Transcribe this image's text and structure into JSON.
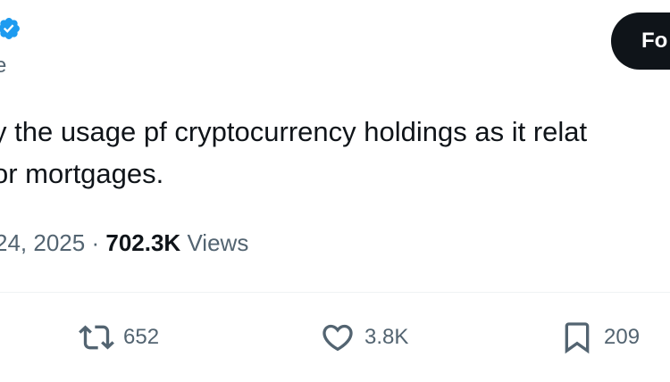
{
  "header": {
    "handle_fragment": "e",
    "follow_label": "Fo"
  },
  "tweet": {
    "line1": "y the usage pf cryptocurrency holdings as it relat",
    "line2": "or mortgages.",
    "date": "24, 2025",
    "separator": "·",
    "views_count": "702.3K",
    "views_label": "Views"
  },
  "actions": {
    "retweets": "652",
    "likes": "3.8K",
    "bookmarks": "209"
  },
  "colors": {
    "verified": "#1d9bf0",
    "text": "#0f1419",
    "muted": "#536471",
    "divider": "#eff3f4"
  }
}
